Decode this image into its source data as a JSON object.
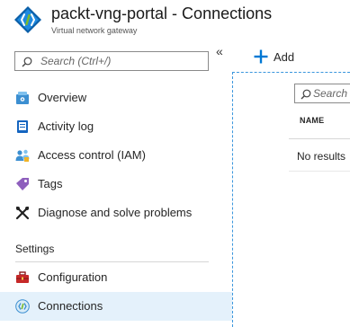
{
  "header": {
    "title": "packt-vng-portal - Connections",
    "subtitle": "Virtual network gateway",
    "logo_icon": "vpn-gateway-icon"
  },
  "sidebar": {
    "search_placeholder": "Search (Ctrl+/)",
    "collapse_label": "«",
    "items": [
      {
        "label": "Overview",
        "icon": "overview-icon"
      },
      {
        "label": "Activity log",
        "icon": "activity-log-icon"
      },
      {
        "label": "Access control (IAM)",
        "icon": "iam-icon"
      },
      {
        "label": "Tags",
        "icon": "tag-icon"
      },
      {
        "label": "Diagnose and solve problems",
        "icon": "wrench-icon"
      }
    ],
    "sections": [
      {
        "label": "Settings",
        "items": [
          {
            "label": "Configuration",
            "icon": "toolbox-icon"
          },
          {
            "label": "Connections",
            "icon": "connections-icon",
            "active": true
          }
        ]
      }
    ]
  },
  "toolbar": {
    "add_label": "Add"
  },
  "grid": {
    "search_placeholder": "Search",
    "columns": [
      "NAME"
    ],
    "empty_text": "No results"
  },
  "colors": {
    "accent": "#0078d4",
    "active_bg": "#e4f1fb",
    "gateway_green": "#7cbb2a"
  }
}
